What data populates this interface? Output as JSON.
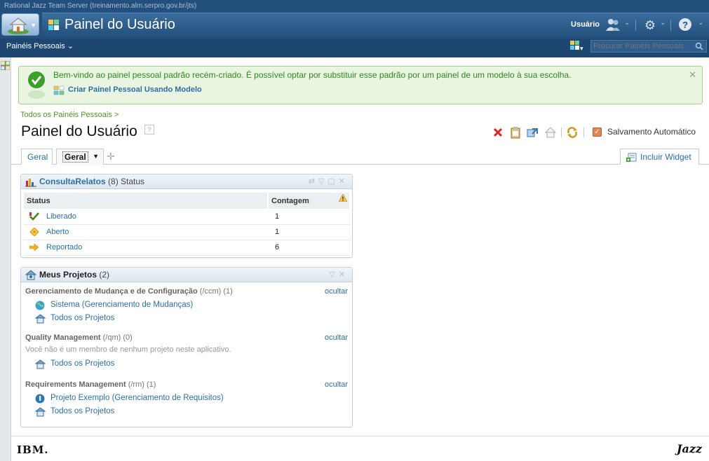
{
  "header": {
    "server_title": "Rational Jazz Team Server (treinamento.alm.serpro.gov.br/jts)",
    "page_heading": "Painel do Usuário",
    "user_label": "Usuário",
    "personal_dashboards_menu": "Painéis Pessoais ⌄",
    "search_placeholder": "Procurar Painéis Pessoais"
  },
  "welcome": {
    "message": "Bem-vindo ao painel pessoal padrão recém-criado. É possível optar por substituir esse padrão por um painel de um modelo à sua escolha.",
    "create_link": "Criar Painel Pessoal Usando Modelo"
  },
  "dashboard": {
    "breadcrumb": "Todos os Painéis Pessoais >",
    "title": "Painel do Usuário",
    "autosave_label": "Salvamento Automático",
    "autosave_checked": true,
    "tabs": [
      {
        "label": "Geral",
        "active": false
      },
      {
        "label": "Geral",
        "active": true
      }
    ],
    "add_widget_label": "Incluir Widget"
  },
  "widget_status": {
    "title_link": "ConsultaRelatos",
    "title_suffix": " (8) Status",
    "columns": [
      "Status",
      "Contagem"
    ],
    "rows": [
      {
        "status": "Liberado",
        "count": "1",
        "icon": "check-icon",
        "color": "#3a8a1a"
      },
      {
        "status": "Aberto",
        "count": "1",
        "icon": "diamond-icon",
        "color": "#e89a1c"
      },
      {
        "status": "Reportado",
        "count": "6",
        "icon": "arrow-right-icon",
        "color": "#e8a11c"
      }
    ]
  },
  "widget_projects": {
    "title": "Meus Projetos",
    "count_label": " (2)",
    "hide_label": "ocultar",
    "groups": [
      {
        "name": "Gerenciamento de Mudança e de Configuração",
        "meta": " (/ccm) (1)",
        "items": [
          "Sistema (Gerenciamento de Mudanças)",
          "Todos os Projetos"
        ]
      },
      {
        "name": "Quality Management",
        "meta": " (/qm) (0)",
        "note": "Você não é um membro de nenhum projeto neste aplicativo.",
        "items": [
          "Todos os Projetos"
        ]
      },
      {
        "name": "Requirements Management",
        "meta": " (/rm) (1)",
        "items": [
          "Projeto Exemplo (Gerenciamento de Requisitos)",
          "Todos os Projetos"
        ]
      }
    ]
  },
  "footer": {
    "ibm_logo": "IBM.",
    "jazz_logo": "Jazz"
  },
  "colors": {
    "header_bg": "#224f7c",
    "link": "#2a6fa8",
    "welcome_bg": "#e9f4e1",
    "welcome_text": "#2b8a1a"
  }
}
